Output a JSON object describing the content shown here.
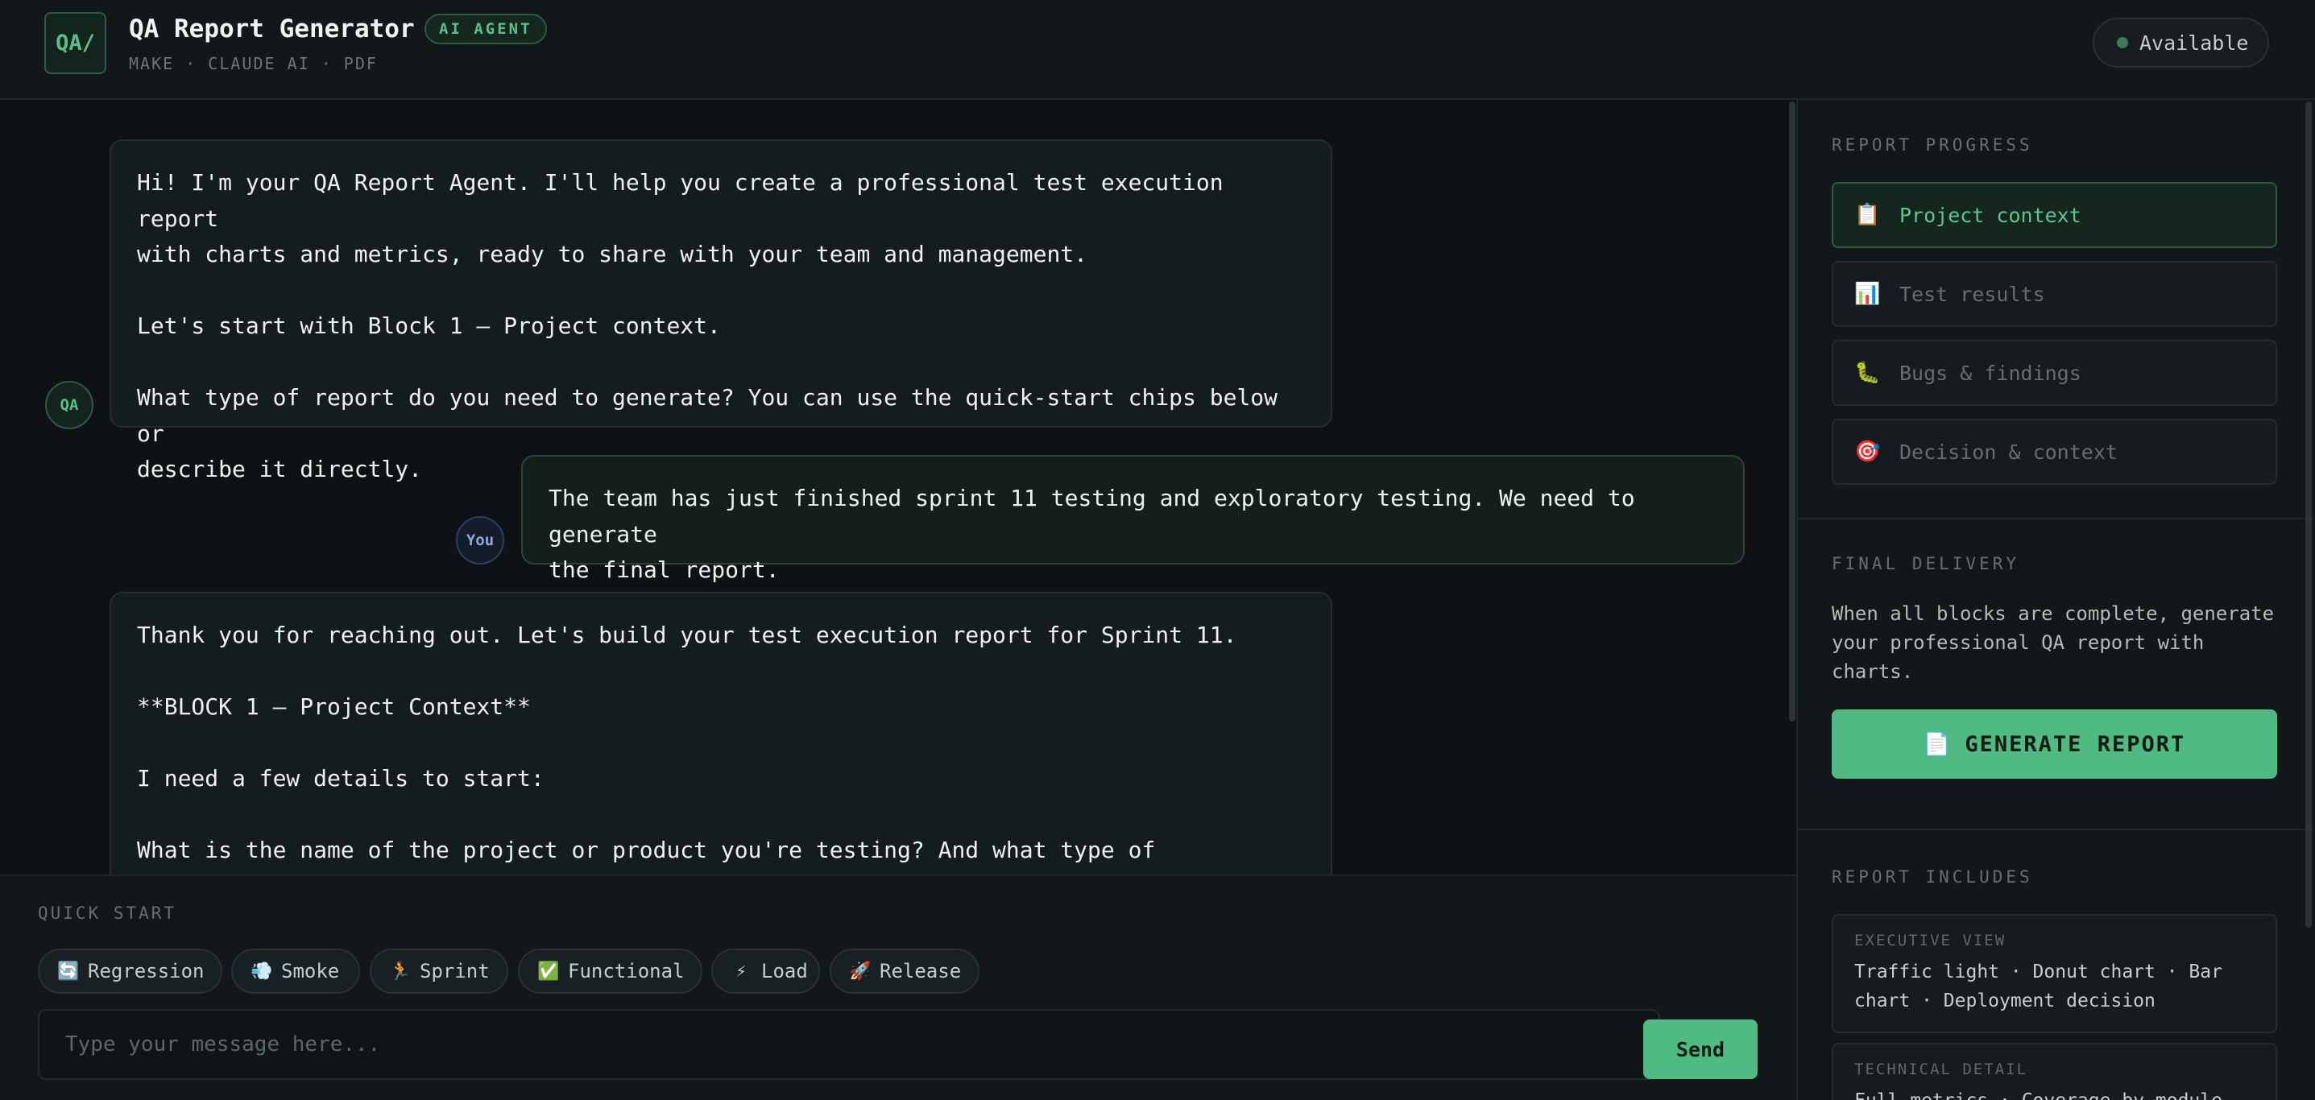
{
  "header": {
    "logo": "QA/",
    "title": "QA Report Generator",
    "badge": "AI AGENT",
    "subtitle": "MAKE · CLAUDE AI · PDF",
    "status": "Available",
    "status_color": "#3a7a57"
  },
  "chat": {
    "messages": [
      {
        "sender": "agent",
        "avatar": "QA",
        "text": "Hi! I'm your QA Report Agent. I'll help you create a professional test execution report\nwith charts and metrics, ready to share with your team and management.\n\nLet's start with Block 1 — Project context.\n\nWhat type of report do you need to generate? You can use the quick-start chips below or\ndescribe it directly."
      },
      {
        "sender": "user",
        "avatar": "You",
        "text": "The team has just finished sprint 11 testing and exploratory testing. We need to generate\nthe final report."
      },
      {
        "sender": "agent",
        "avatar": "",
        "text": "Thank you for reaching out. Let's build your test execution report for Sprint 11.\n\n**BLOCK 1 — Project Context**\n\nI need a few details to start:\n\nWhat is the name of the project or product you're testing? And what type of application\nis it — web, mobile, API, desktop, or a combination?"
      }
    ]
  },
  "quick_start": {
    "label": "QUICK START",
    "chips": [
      {
        "icon": "🔄",
        "icon_name": "repeat-icon",
        "label": "Regression"
      },
      {
        "icon": "💨",
        "icon_name": "smoke-icon",
        "label": "Smoke"
      },
      {
        "icon": "🏃",
        "icon_name": "runner-icon",
        "label": "Sprint"
      },
      {
        "icon": "✅",
        "icon_name": "check-icon",
        "label": "Functional"
      },
      {
        "icon": "⚡",
        "icon_name": "lightning-icon",
        "label": "Load"
      },
      {
        "icon": "🚀",
        "icon_name": "rocket-icon",
        "label": "Release"
      }
    ]
  },
  "composer": {
    "placeholder": "Type your message here...",
    "value": "",
    "send_label": "Send"
  },
  "sidebar": {
    "progress_label": "REPORT PROGRESS",
    "steps": [
      {
        "icon": "📋",
        "icon_name": "clipboard-icon",
        "label": "Project context",
        "state": "active"
      },
      {
        "icon": "📊",
        "icon_name": "bar-chart-icon",
        "label": "Test results",
        "state": "pending"
      },
      {
        "icon": "🐛",
        "icon_name": "bug-icon",
        "label": "Bugs & findings",
        "state": "pending"
      },
      {
        "icon": "🎯",
        "icon_name": "target-icon",
        "label": "Decision & context",
        "state": "pending"
      }
    ],
    "delivery_label": "FINAL DELIVERY",
    "delivery_text": "When all blocks are complete, generate your professional QA report with charts.",
    "generate_icon": "📄",
    "generate_label": "GENERATE REPORT",
    "includes_label": "REPORT INCLUDES",
    "includes": [
      {
        "title": "EXECUTIVE VIEW",
        "desc": "Traffic light · Donut chart · Bar chart · Deployment decision"
      },
      {
        "title": "TECHNICAL DETAIL",
        "desc": "Full metrics · Coverage by module"
      }
    ],
    "accent_color": "#4fba82"
  }
}
